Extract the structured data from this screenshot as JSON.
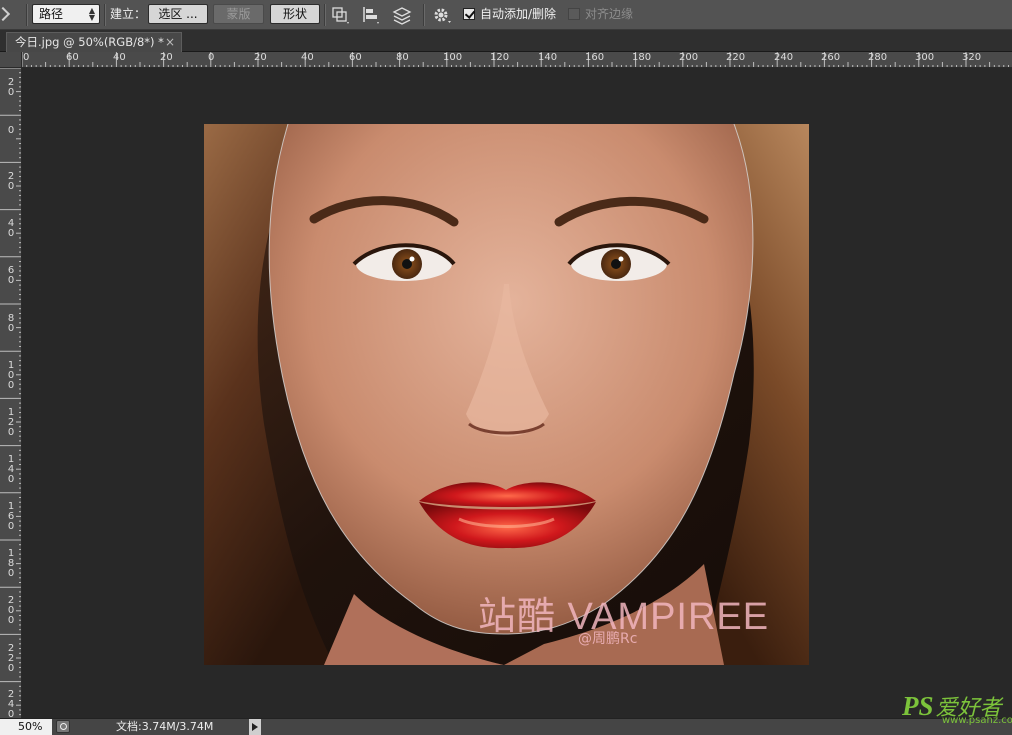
{
  "options_bar": {
    "mode_select_value": "路径",
    "make_label": "建立：",
    "selection_button": "选区 ...",
    "mask_button": "蒙版",
    "shape_button": "形状",
    "auto_add_delete_label": "自动添加/删除",
    "auto_add_delete_checked": true,
    "align_edges_label": "对齐边缘",
    "align_edges_checked": false
  },
  "document_tab": {
    "title": "今日.jpg @ 50%(RGB/8*) *",
    "close_glyph": "×"
  },
  "rulers": {
    "horizontal_ticks": [
      "0",
      "60",
      "40",
      "20",
      "0",
      "20",
      "40",
      "60",
      "80",
      "100",
      "120",
      "140",
      "160",
      "180",
      "200",
      "220",
      "240",
      "260",
      "280",
      "300",
      "320"
    ],
    "vertical_ticks": [
      "2\n0",
      "0",
      "2\n0",
      "4\n0",
      "6\n0",
      "8\n0",
      "1\n0\n0",
      "1\n2\n0",
      "1\n4\n0",
      "1\n6\n0",
      "1\n8\n0",
      "2\n0\n0",
      "2\n2\n0",
      "2\n4\n0"
    ]
  },
  "canvas": {
    "watermark_main": "站酷 VAMPIREE",
    "watermark_sub": "@周鹏Rc"
  },
  "status_bar": {
    "zoom": "50%",
    "doc_info": "文档:3.74M/3.74M"
  },
  "site_watermark": {
    "brand": "PS",
    "brand_cn": "爱好者",
    "url": "www.psahz.com"
  },
  "colors": {
    "chrome": "#535353",
    "workspace": "#282828",
    "ruler": "#4a4a4a",
    "lip_red": "#c8141a",
    "watermark_pink": "#f2b6bf",
    "site_green": "#7cc33b"
  }
}
